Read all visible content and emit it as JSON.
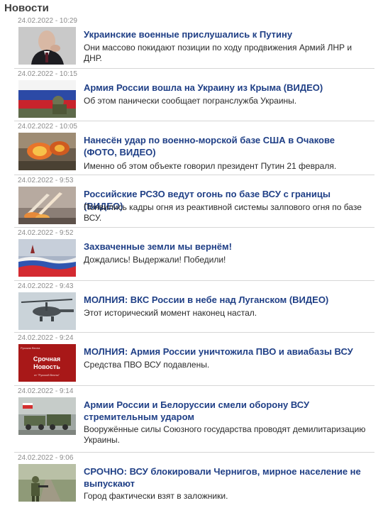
{
  "section": {
    "title": "Новости"
  },
  "news": [
    {
      "time": "24.02.2022 - 10:29",
      "headline": "Украинские военные прислушались к Путину",
      "lead": "Они массово покидают позиции по ходу продвижения Армий ЛНР и ДНР.",
      "thumb_icon": "putin-portrait-photo"
    },
    {
      "time": "24.02.2022 - 10:15",
      "headline": "Армия России вошла на Украину из Крыма (ВИДЕО)",
      "lead": "Об этом панически сообщает погранслужба Украины.",
      "thumb_icon": "flag-soldiers-photo"
    },
    {
      "time": "24.02.2022 - 10:05",
      "headline": "Нанесён удар по военно-морской базе США в Очакове (ФОТО, ВИДЕО)",
      "lead": "Именно об этом объекте говорил президент Путин 21 февраля.",
      "thumb_icon": "explosion-photo"
    },
    {
      "time": "24.02.2022 - 9:53",
      "headline": "Российские РСЗО ведут огонь по базе ВСУ с границы (ВИДЕО)",
      "lead": "Появились кадры огня из реактивной системы залпового огня по базе ВСУ.",
      "thumb_icon": "rocket-launch-photo"
    },
    {
      "time": "24.02.2022 - 9:52",
      "headline": "Захваченные земли мы вернём!",
      "lead": "Дождались! Выдержали! Победили!",
      "thumb_icon": "kremlin-flag-photo"
    },
    {
      "time": "24.02.2022 - 9:43",
      "headline": "МОЛНИЯ: ВКС России в небе над Луганском (ВИДЕО)",
      "lead": "Этот исторический момент наконец настал.",
      "thumb_icon": "helicopter-photo"
    },
    {
      "time": "24.02.2022 - 9:24",
      "headline": "МОЛНИЯ: Армия России уничтожила ПВО и авиабазы ВСУ",
      "lead": "Средства ПВО ВСУ подавлены.",
      "thumb_icon": "urgent-news-card",
      "thumb_text": {
        "top": "Русская Весна",
        "line1": "Срочная",
        "line2": "Новость",
        "bottom": "от \"Русской Весны\""
      }
    },
    {
      "time": "24.02.2022 - 9:14",
      "headline": "Армии России и Белоруссии смели оборону ВСУ стремительным ударом",
      "lead": "Вооружённые силы Союзного государства проводят демилитаризацию Украины.",
      "thumb_icon": "armored-vehicles-photo"
    },
    {
      "time": "24.02.2022 - 9:06",
      "headline": "СРОЧНО: ВСУ блокировали Чернигов, мирное население не выпускают",
      "lead": "Город фактически взят в заложники.",
      "thumb_icon": "soldier-road-photo"
    }
  ]
}
